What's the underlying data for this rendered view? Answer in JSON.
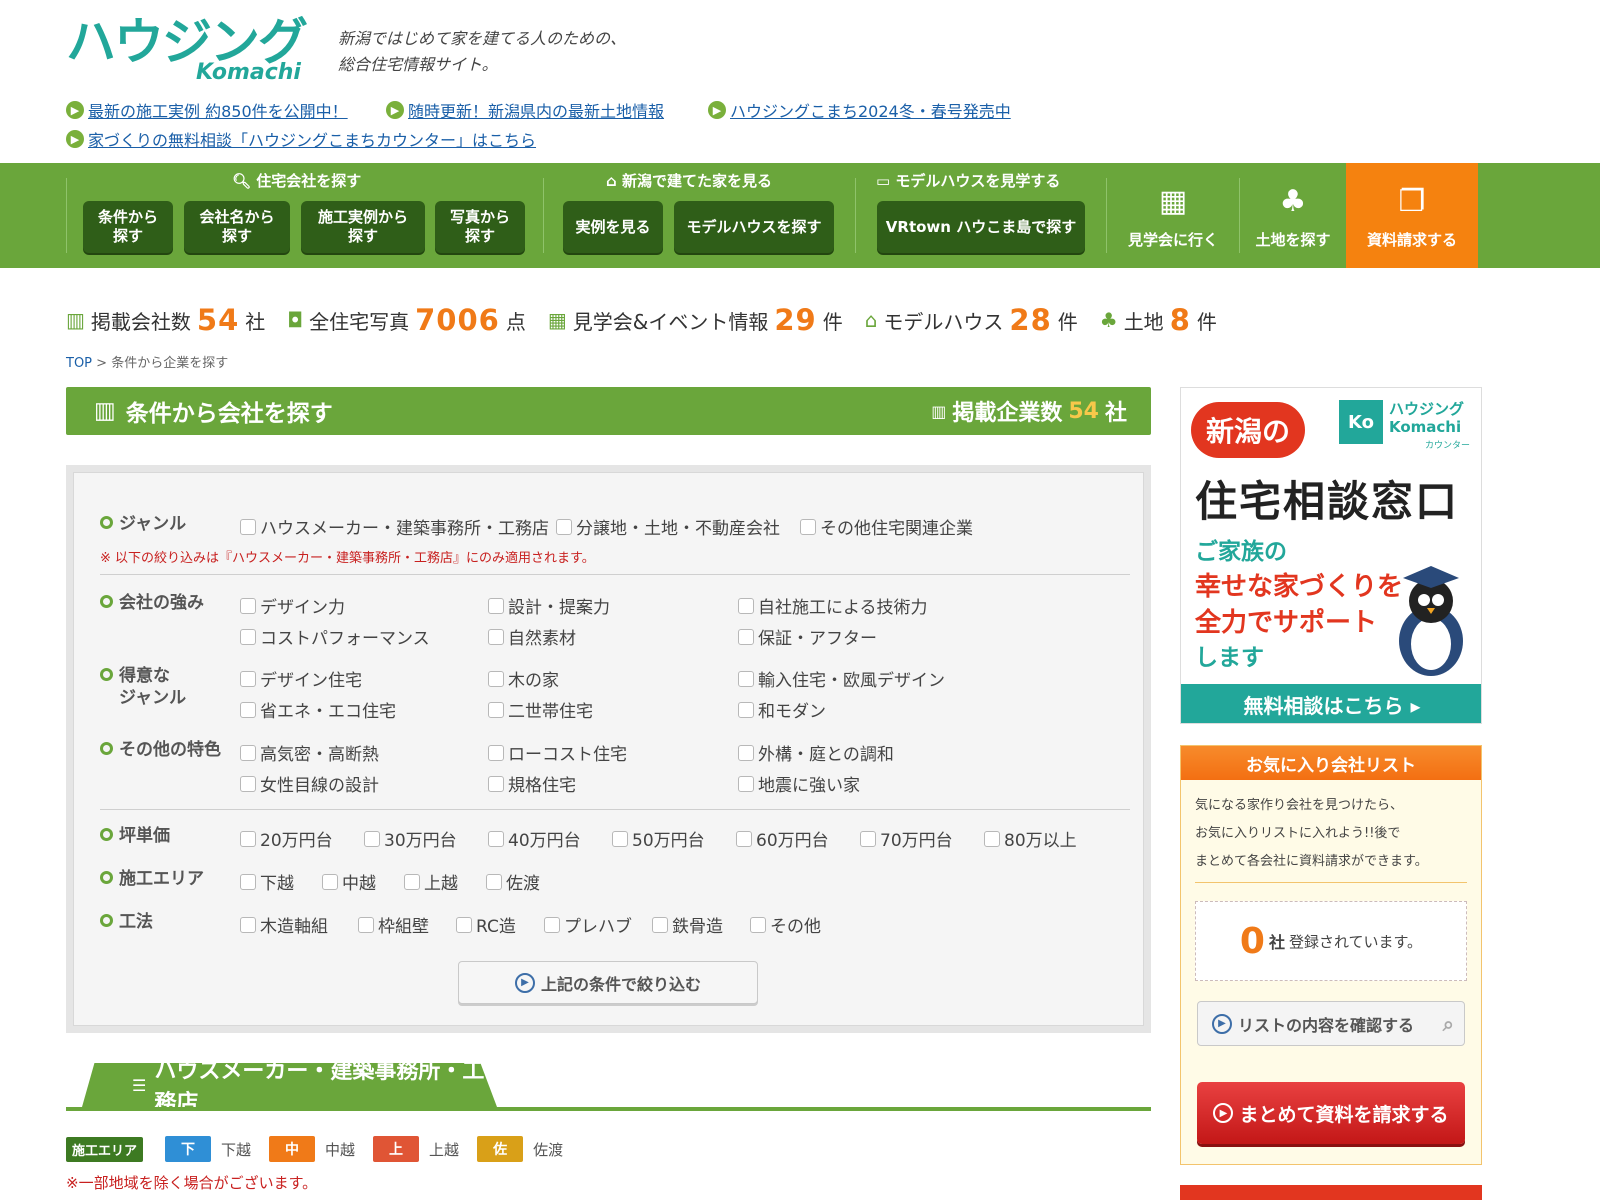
{
  "header": {
    "logo": "ハウジング",
    "logo_sub": "Komachi",
    "tagline1": "新潟ではじめて家を建てる人のための、",
    "tagline2": "総合住宅情報サイト。",
    "notices": [
      "最新の施工実例 約850件を公開中！",
      "随時更新！新潟県内の最新土地情報",
      "ハウジングこまち2024冬・春号発売中",
      "家づくりの無料相談「ハウジングこまちカウンター」はこちら"
    ]
  },
  "nav": {
    "search_title": "住宅会社を探す",
    "search_buttons": [
      "条件から\n探す",
      "会社名から\n探す",
      "施工実例から\n探す",
      "写真から\n探す"
    ],
    "view_title": "新潟で建てた家を見る",
    "view_buttons": [
      "実例を見る",
      "モデルハウスを探す"
    ],
    "model_title": "モデルハウスを見学する",
    "model_button": "VRtown ハウこま島で探す",
    "visit": "見学会に行く",
    "land": "土地を探す",
    "request": "資料請求する"
  },
  "stats": [
    {
      "label": "掲載会社数",
      "num": "54",
      "unit": "社",
      "icon": "building-icon"
    },
    {
      "label": "全住宅写真",
      "num": "7006",
      "unit": "点",
      "icon": "photo-icon"
    },
    {
      "label": "見学会&イベント情報",
      "num": "29",
      "unit": "件",
      "icon": "calendar-icon"
    },
    {
      "label": "モデルハウス",
      "num": "28",
      "unit": "件",
      "icon": "house-icon"
    },
    {
      "label": "土地",
      "num": "8",
      "unit": "件",
      "icon": "tree-icon"
    }
  ],
  "breadcrumb": {
    "top": "TOP",
    "sep": ">",
    "current": "条件から企業を探す"
  },
  "title": {
    "main": "条件から会社を探す",
    "count_label": "掲載企業数",
    "count": "54",
    "unit": "社"
  },
  "form": {
    "genre_label": "ジャンル",
    "genre": [
      "ハウスメーカー・建築事務所・工務店",
      "分譲地・土地・不動産会社",
      "その他住宅関連企業"
    ],
    "note": "※ 以下の絞り込みは『ハウスメーカー・建築事務所・工務店』にのみ適用されます。",
    "strength_label": "会社の強み",
    "strength": [
      "デザイン力",
      "設計・提案力",
      "自社施工による技術力",
      "コストパフォーマンス",
      "自然素材",
      "保証・アフター"
    ],
    "specialty_label1": "得意な",
    "specialty_label2": "ジャンル",
    "specialty": [
      "デザイン住宅",
      "木の家",
      "輸入住宅・欧風デザイン",
      "省エネ・エコ住宅",
      "二世帯住宅",
      "和モダン"
    ],
    "other_label": "その他の特色",
    "other": [
      "高気密・高断熱",
      "ローコスト住宅",
      "外構・庭との調和",
      "女性目線の設計",
      "規格住宅",
      "地震に強い家"
    ],
    "price_label": "坪単価",
    "price": [
      "20万円台",
      "30万円台",
      "40万円台",
      "50万円台",
      "60万円台",
      "70万円台",
      "80万以上"
    ],
    "area_label": "施工エリア",
    "area": [
      "下越",
      "中越",
      "上越",
      "佐渡"
    ],
    "method_label": "工法",
    "method": [
      "木造軸組",
      "枠組壁",
      "RC造",
      "プレハブ",
      "鉄骨造",
      "その他"
    ],
    "submit": "上記の条件で絞り込む"
  },
  "section": {
    "tab": "ハウスメーカー・建築事務所・工務店",
    "legend_title": "施工エリア",
    "legend": [
      {
        "s": "下",
        "l": "下越",
        "c": "#2f8fd6"
      },
      {
        "s": "中",
        "l": "中越",
        "c": "#f07a18"
      },
      {
        "s": "上",
        "l": "上越",
        "c": "#e05535"
      },
      {
        "s": "佐",
        "l": "佐渡",
        "c": "#d9a018"
      }
    ],
    "exception": "※一部地域を除く場合がございます。"
  },
  "banner": {
    "niigata": "新潟の",
    "logo": "ハウジング Komachi",
    "logo_sub": "カウンター",
    "title": "住宅相談窓口",
    "line1": "ご家族の",
    "line2": "幸せな家づくりを",
    "line3": "全力でサポート",
    "line4": "します",
    "cta": "無料相談はこちら ▸"
  },
  "favorites": {
    "head": "お気に入り会社リスト",
    "text1": "気になる家作り会社を見つけたら、",
    "text2": "お気に入りリストに入れよう!!後で",
    "text3": "まとめて各会社に資料請求ができます。",
    "count": "0",
    "unit": "社",
    "registered": "登録されています。",
    "check": "リストの内容を確認する",
    "request": "まとめて資料を請求する"
  }
}
